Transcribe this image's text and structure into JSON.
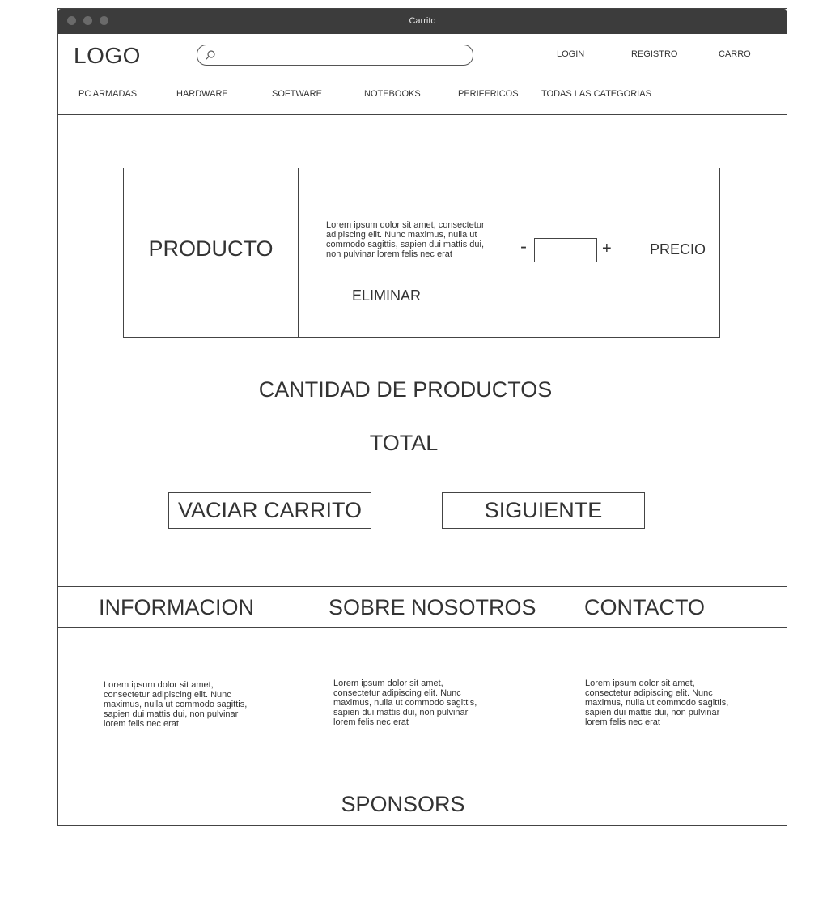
{
  "window": {
    "title": "Carrito"
  },
  "header": {
    "logo": "LOGO",
    "search": {
      "value": "",
      "placeholder": ""
    },
    "links": {
      "login": "LOGIN",
      "registro": "REGISTRO",
      "carro": "CARRO"
    }
  },
  "nav": {
    "items": [
      "PC ARMADAS",
      "HARDWARE",
      "SOFTWARE",
      "NOTEBOOKS",
      "PERIFERICOS",
      "TODAS LAS CATEGORIAS"
    ]
  },
  "cart_item": {
    "product_label": "PRODUCTO",
    "description": "Lorem ipsum dolor sit amet, consectetur adipiscing elit. Nunc maximus, nulla ut commodo sagittis, sapien dui mattis dui, non pulvinar lorem felis nec erat",
    "remove_label": "ELIMINAR",
    "decrement_label": "-",
    "quantity": "",
    "increment_label": "+",
    "price_label": "PRECIO"
  },
  "summary": {
    "count_label": "CANTIDAD DE PRODUCTOS",
    "total_label": "TOTAL"
  },
  "actions": {
    "empty_cart": "VACIAR CARRITO",
    "next": "SIGUIENTE"
  },
  "footer": {
    "sections": [
      {
        "title": "INFORMACION",
        "text": "Lorem ipsum dolor sit amet, consectetur adipiscing elit. Nunc maximus, nulla ut commodo sagittis, sapien dui mattis dui, non pulvinar lorem felis nec erat"
      },
      {
        "title": "SOBRE NOSOTROS",
        "text": "Lorem ipsum dolor sit amet, consectetur adipiscing elit. Nunc maximus, nulla ut commodo sagittis, sapien dui mattis dui, non pulvinar lorem felis nec erat"
      },
      {
        "title": "CONTACTO",
        "text": "Lorem ipsum dolor sit amet, consectetur adipiscing elit. Nunc maximus, nulla ut commodo sagittis, sapien dui mattis dui, non pulvinar lorem felis nec erat"
      }
    ],
    "sponsors": "SPONSORS"
  },
  "icons": {
    "search": "search-icon"
  },
  "colors": {
    "titlebar": "#3c3c3c",
    "border": "#444444",
    "text": "#333333"
  }
}
